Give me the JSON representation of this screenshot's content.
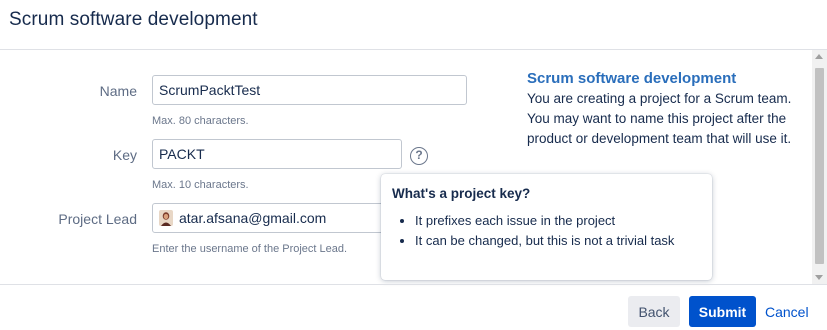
{
  "dialog": {
    "title": "Scrum software development"
  },
  "form": {
    "name": {
      "label": "Name",
      "value": "ScrumPacktTest",
      "hint": "Max. 80 characters."
    },
    "key": {
      "label": "Key",
      "value": "PACKT",
      "hint": "Max. 10 characters.",
      "help_icon": "?"
    },
    "project_lead": {
      "label": "Project Lead",
      "value": "atar.afsana@gmail.com",
      "hint": "Enter the username of the Project Lead."
    }
  },
  "info_panel": {
    "title": "Scrum software development",
    "text": "You are creating a project for a Scrum team. You may want to name this project after the product or development team that will use it."
  },
  "tooltip": {
    "title": "What's a project key?",
    "items": [
      "It prefixes each issue in the project",
      "It can be changed, but this is not a trivial task"
    ]
  },
  "footer": {
    "back_label": "Back",
    "submit_label": "Submit",
    "cancel_label": "Cancel"
  },
  "colors": {
    "primary": "#0052cc",
    "info_title": "#2a6ebb",
    "text": "#172b4d",
    "muted": "#6b778c"
  },
  "icons": {
    "help": "question-circle-icon",
    "avatar": "user-avatar-icon"
  }
}
